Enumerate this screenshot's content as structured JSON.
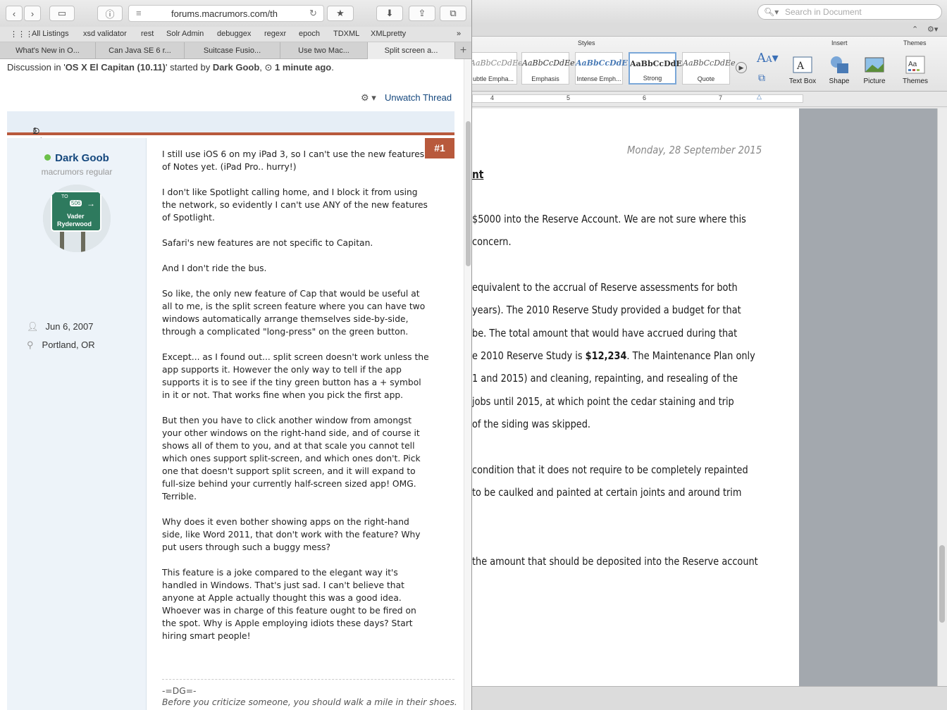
{
  "safari": {
    "url": "forums.macrumors.com/th",
    "bookmarks": [
      "All Listings",
      "xsd validator",
      "rest",
      "Solr Admin",
      "debuggex",
      "regexr",
      "epoch",
      "TDXML",
      "XMLpretty"
    ],
    "tabs": [
      "What's New in O...",
      "Can Java SE 6 r...",
      "Suitcase Fusio...",
      "Use two Mac...",
      "Split screen a..."
    ],
    "discussion_prefix": "Discussion in '",
    "forum": "OS X El Capitan (10.11)",
    "started_by": "' started by ",
    "starter": "Dark Goob",
    "when": "1 minute ago",
    "unwatch": "Unwatch Thread",
    "post_time": "1 minute ago",
    "post_number": "#1",
    "user": {
      "name": "Dark Goob",
      "title": "macrumors regular",
      "sign_line1": "TO",
      "sign_num": "506",
      "sign_line2": "Vader",
      "sign_line3": "Ryderwood",
      "joined": "Jun 6, 2007",
      "location": "Portland, OR"
    },
    "post_paragraphs": [
      "I still use iOS 6 on my iPad 3, so I can't use the new features of Notes yet. (iPad Pro.. hurry!)",
      "I don't like Spotlight calling home, and I block it from using the network, so evidently I can't use ANY of the new features of Spotlight.",
      "Safari's new features are not specific to Capitan.",
      "And I don't ride the bus.",
      "So like, the only new feature of Cap that would be useful at all to me, is the split screen feature where you can have two windows automatically arrange themselves side-by-side, through a complicated \"long-press\" on the green button.",
      "Except... as I found out... split screen doesn't work unless the app supports it. However the only way to tell if the app supports it is to see if the tiny green button has a + symbol in it or not. That works fine when you pick the first app.",
      "But then you have to click another window from amongst your other windows on the right-hand side, and of course it shows all of them to you, and at that scale you cannot tell which ones support split-screen, and which ones don't. Pick one that doesn't support split screen, and it will expand to full-size behind your currently half-screen sized app! OMG. Terrible.",
      "Why does it even bother showing apps on the right-hand side, like Word 2011, that don't work with the feature? Why put users through such a buggy mess?",
      "This feature is a joke compared to the elegant way it's handled in Windows. That's just sad. I can't believe that anyone at Apple actually thought this was a good idea. Whoever was in charge of this feature ought to be fired on the spot. Why is Apple employing idiots these days? Start hiring smart people!"
    ],
    "signature_name": "-=DG=-",
    "signature_quote": "Before you criticize someone, you should walk a mile in their shoes."
  },
  "word": {
    "search_placeholder": "Search in Document",
    "groups": {
      "styles": "Styles",
      "insert": "Insert",
      "themes": "Themes"
    },
    "styles": [
      {
        "sample": "AaBbCcDdEe",
        "label": "ubtle Empha..."
      },
      {
        "sample": "AaBbCcDdEe",
        "label": "Emphasis"
      },
      {
        "sample": "AaBbCcDdE",
        "label": "Intense Emph..."
      },
      {
        "sample": "AaBbCcDdEe",
        "label": "Strong"
      },
      {
        "sample": "AaBbCcDdEe",
        "label": "Quote"
      }
    ],
    "insert": [
      "Text Box",
      "Shape",
      "Picture"
    ],
    "themes_label": "Themes",
    "ruler": [
      "4",
      "5",
      "6",
      "7"
    ],
    "date": "Monday, 28 September 2015",
    "heading_frag": "nt",
    "lines": [
      "$5000 into the Reserve Account. We are not sure where this",
      " concern.",
      "equivalent to the accrual of Reserve assessments for both",
      " years). The 2010 Reserve Study provided a budget for that",
      "be. The total amount that would have accrued during that",
      "e 2010 Reserve Study is ",
      "1 and 2015) and cleaning, repainting, and resealing of the",
      " jobs until 2015, at which point the cedar staining and trip",
      "of the siding was skipped.",
      "condition that it does not require to be completely repainted",
      "to be caulked and painted at certain joints and around trim",
      "the amount that should be deposited into the Reserve account"
    ],
    "amount": "$12,234",
    "amount_tail": ". The Maintenance Plan only"
  }
}
